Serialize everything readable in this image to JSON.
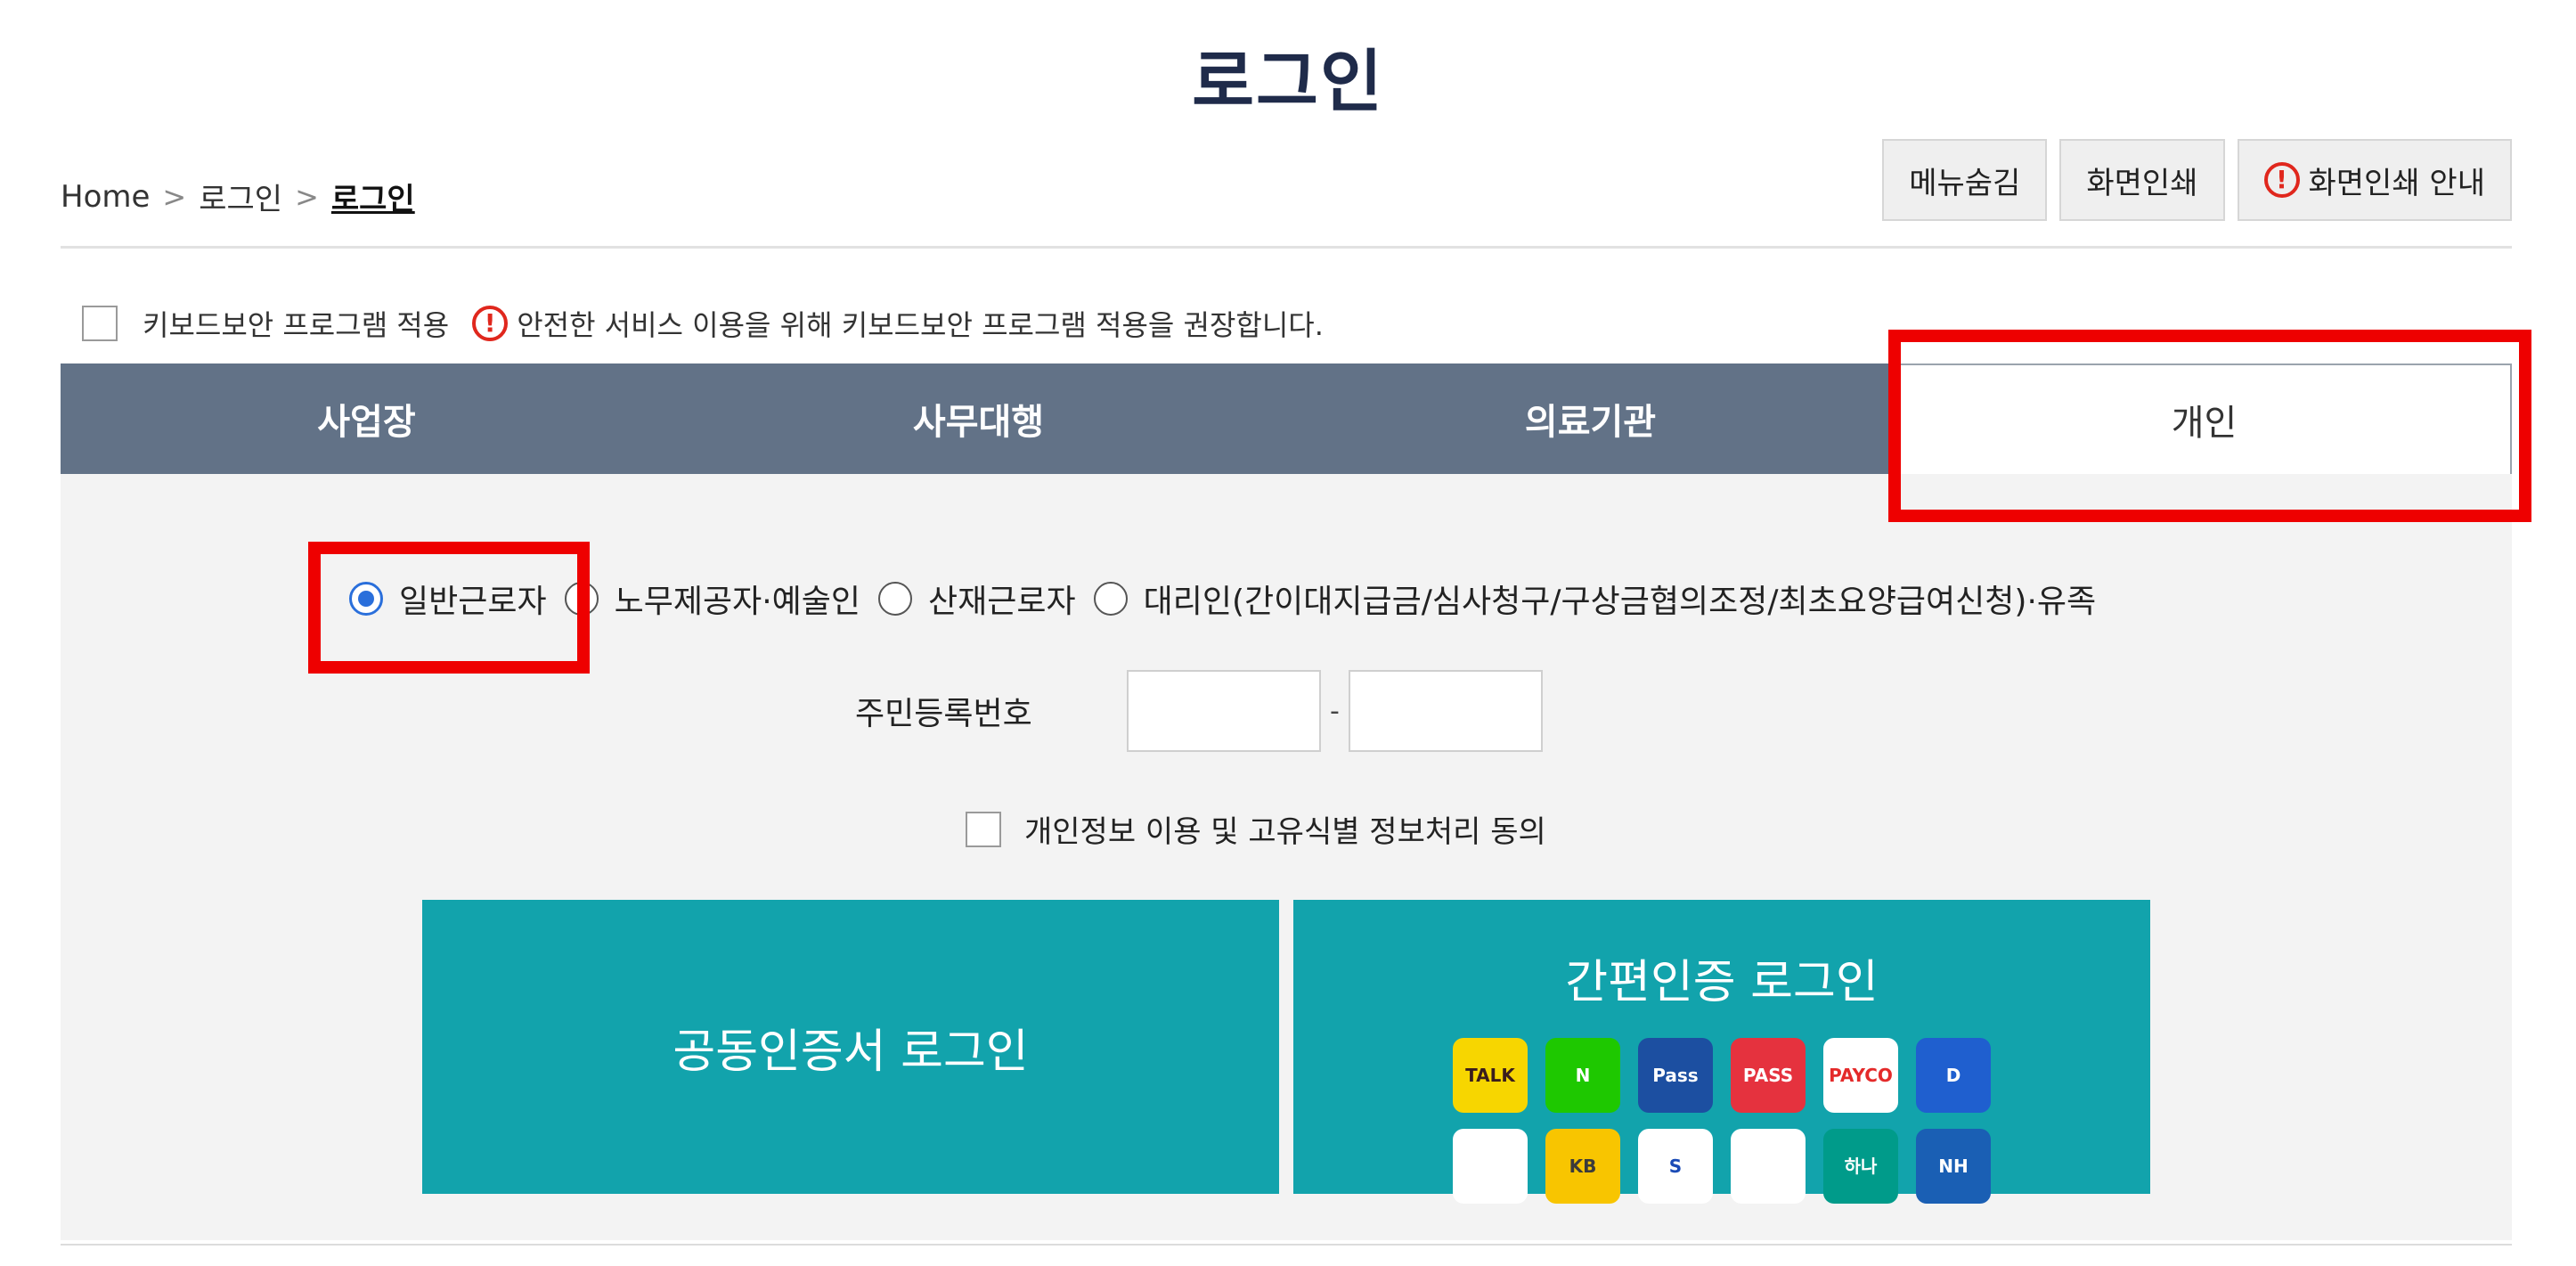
{
  "page": {
    "title": "로그인"
  },
  "breadcrumb": {
    "items": [
      "Home",
      "로그인",
      "로그인"
    ],
    "separator": ">"
  },
  "top_buttons": {
    "hide_menu": "메뉴숨김",
    "print": "화면인쇄",
    "print_info": "화면인쇄 안내"
  },
  "keyboard_security": {
    "label": "키보드보안 프로그램 적용",
    "notice": "안전한 서비스 이용을 위해 키보드보안 프로그램 적용을 권장합니다."
  },
  "tabs": [
    {
      "label": "사업장",
      "active": false
    },
    {
      "label": "사무대행",
      "active": false
    },
    {
      "label": "의료기관",
      "active": false
    },
    {
      "label": "개인",
      "active": true
    }
  ],
  "user_types": [
    {
      "label": "일반근로자",
      "checked": true
    },
    {
      "label": "노무제공자·예술인",
      "checked": false
    },
    {
      "label": "산재근로자",
      "checked": false
    },
    {
      "label": "대리인(간이대지급금/심사청구/구상금협의조정/최초요양급여신청)·유족",
      "checked": false
    }
  ],
  "rrn": {
    "label": "주민등록번호",
    "separator": "-",
    "front_value": "",
    "back_value": ""
  },
  "consent": {
    "label": "개인정보 이용 및 고유식별 정보처리 동의"
  },
  "login": {
    "certificate_label": "공동인증서 로그인",
    "simple_auth_label": "간편인증 로그인",
    "auth_providers": [
      {
        "name": "kakaotalk-icon",
        "text": "TALK",
        "bg": "#f7d600",
        "fg": "#3a1d1d"
      },
      {
        "name": "naver-icon",
        "text": "N",
        "bg": "#1ec800",
        "fg": "#ffffff"
      },
      {
        "name": "samsung-pass-icon",
        "text": "Pass",
        "bg": "#1c4fa1",
        "fg": "#ffffff"
      },
      {
        "name": "pass-icon",
        "text": "PASS",
        "bg": "#e5323e",
        "fg": "#ffffff"
      },
      {
        "name": "payco-icon",
        "text": "PAYCO",
        "bg": "#ffffff",
        "fg": "#e42a2a"
      },
      {
        "name": "digital-id-icon",
        "text": "D",
        "bg": "#1f5fcf",
        "fg": "#ffffff"
      },
      {
        "name": "toss-icon",
        "text": "",
        "bg": "#ffffff",
        "fg": "#1b64da"
      },
      {
        "name": "kb-bank-icon",
        "text": "KB",
        "bg": "#f8c500",
        "fg": "#3b3b3b"
      },
      {
        "name": "shinhan-bank-icon",
        "text": "S",
        "bg": "#ffffff",
        "fg": "#1a4bb6"
      },
      {
        "name": "smile-cert-icon",
        "text": "",
        "bg": "#ffffff",
        "fg": "#1faa6b"
      },
      {
        "name": "hana-bank-icon",
        "text": "하나",
        "bg": "#009b8a",
        "fg": "#ffffff"
      },
      {
        "name": "nh-bank-icon",
        "text": "NH",
        "bg": "#1a5fb4",
        "fg": "#ffffff"
      }
    ]
  },
  "colors": {
    "tab_bar": "#627287",
    "teal_button": "#12a3ac",
    "highlight_red": "#ee0000",
    "title_navy": "#1f2b4a"
  }
}
